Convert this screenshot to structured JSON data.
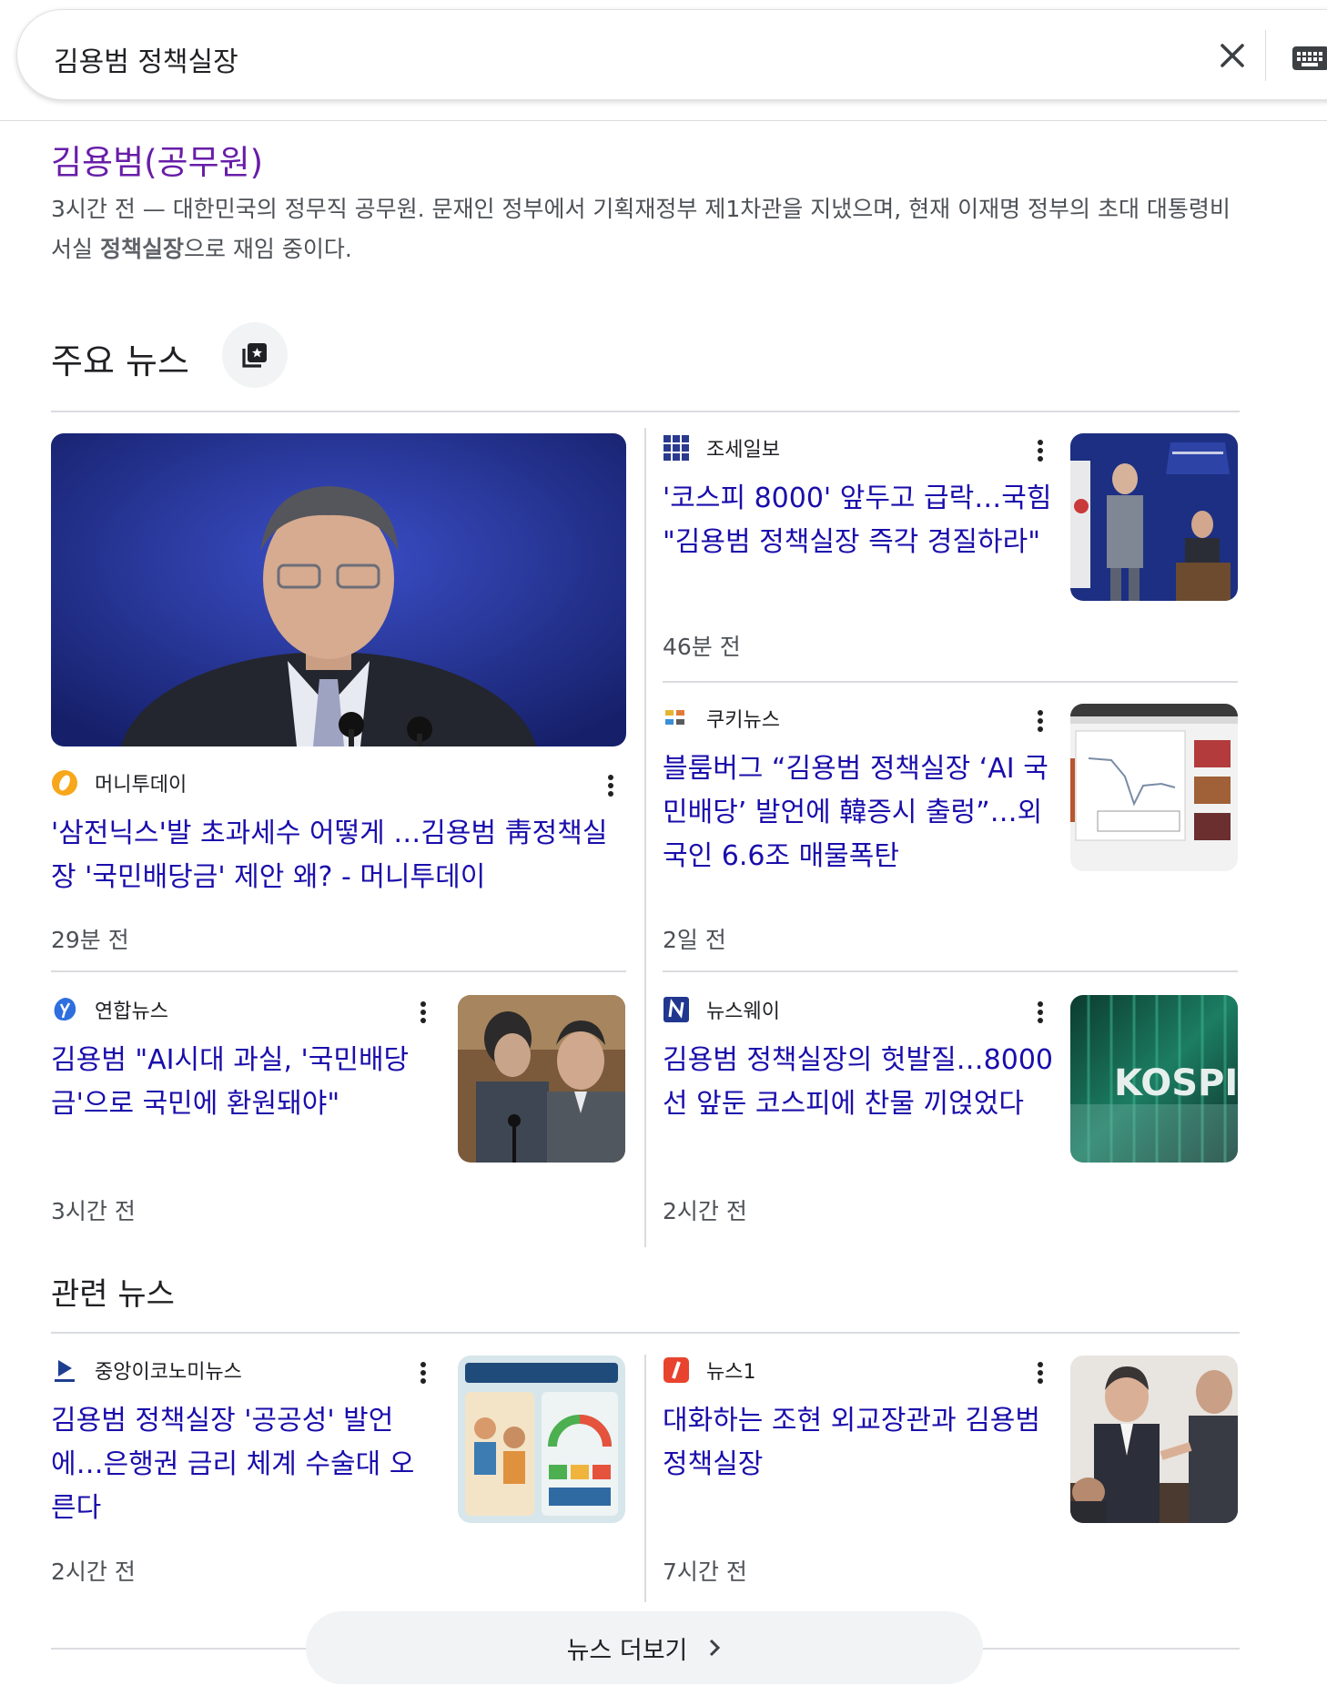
{
  "search": {
    "query": "김용범 정책실장"
  },
  "top_result": {
    "title": "김용범(공무원)",
    "snippet_prefix": "3시간 전 — 대한민국의 정무직 공무원. 문재인 정부에서 기획재정부 제1차관을 지냈으며, 현재 이재명 정부의 초대 대통령비서실 ",
    "snippet_bold": "정책실장",
    "snippet_suffix": "으로 재임 중이다."
  },
  "top_news": {
    "heading": "주요 뉴스",
    "articles": [
      {
        "source": "머니투데이",
        "headline": "'삼전닉스'발 초과세수 어떻게 …김용범 靑정책실장 '국민배당금' 제안 왜? - 머니투데이",
        "time": "29분 전"
      },
      {
        "source": "조세일보",
        "headline": "'코스피 8000' 앞두고 급락…국힘 \"김용범 정책실장 즉각 경질하라\"",
        "time": "46분 전"
      },
      {
        "source": "쿠키뉴스",
        "headline": "블룸버그 “김용범 정책실장 ‘AI 국민배당’ 발언에 韓증시 출렁”…외국인 6.6조 매물폭탄",
        "time": "2일 전"
      },
      {
        "source": "연합뉴스",
        "headline": "김용범 \"AI시대 과실, '국민배당금'으로 국민에 환원돼야\"",
        "time": "3시간 전"
      },
      {
        "source": "뉴스웨이",
        "headline": "김용범 정책실장의 헛발질…8000선 앞둔 코스피에 찬물 끼얹었다",
        "time": "2시간 전"
      }
    ]
  },
  "related_news": {
    "heading": "관련 뉴스",
    "articles": [
      {
        "source": "중앙이코노미뉴스",
        "headline": "김용범 정책실장 '공공성' 발언에…은행권 금리 체계 수술대 오른다",
        "time": "2시간 전"
      },
      {
        "source": "뉴스1",
        "headline": "대화하는 조현 외교장관과 김용범 정책실장",
        "time": "7시간 전"
      }
    ]
  },
  "thumb_text": {
    "kospi": "KOSPI"
  },
  "more_news": {
    "label": "뉴스 더보기"
  },
  "icons": {
    "clear": "close-icon",
    "keyboard": "keyboard-icon",
    "news_mode": "news-icon",
    "more": "more-vert-icon",
    "chevron": "chevron-right-icon"
  },
  "colors": {
    "link": "#1a0dab",
    "visited_title": "#681da8",
    "meta_text": "#4d5156",
    "divider": "#dadce0",
    "pill_bg": "#f1f3f4"
  }
}
